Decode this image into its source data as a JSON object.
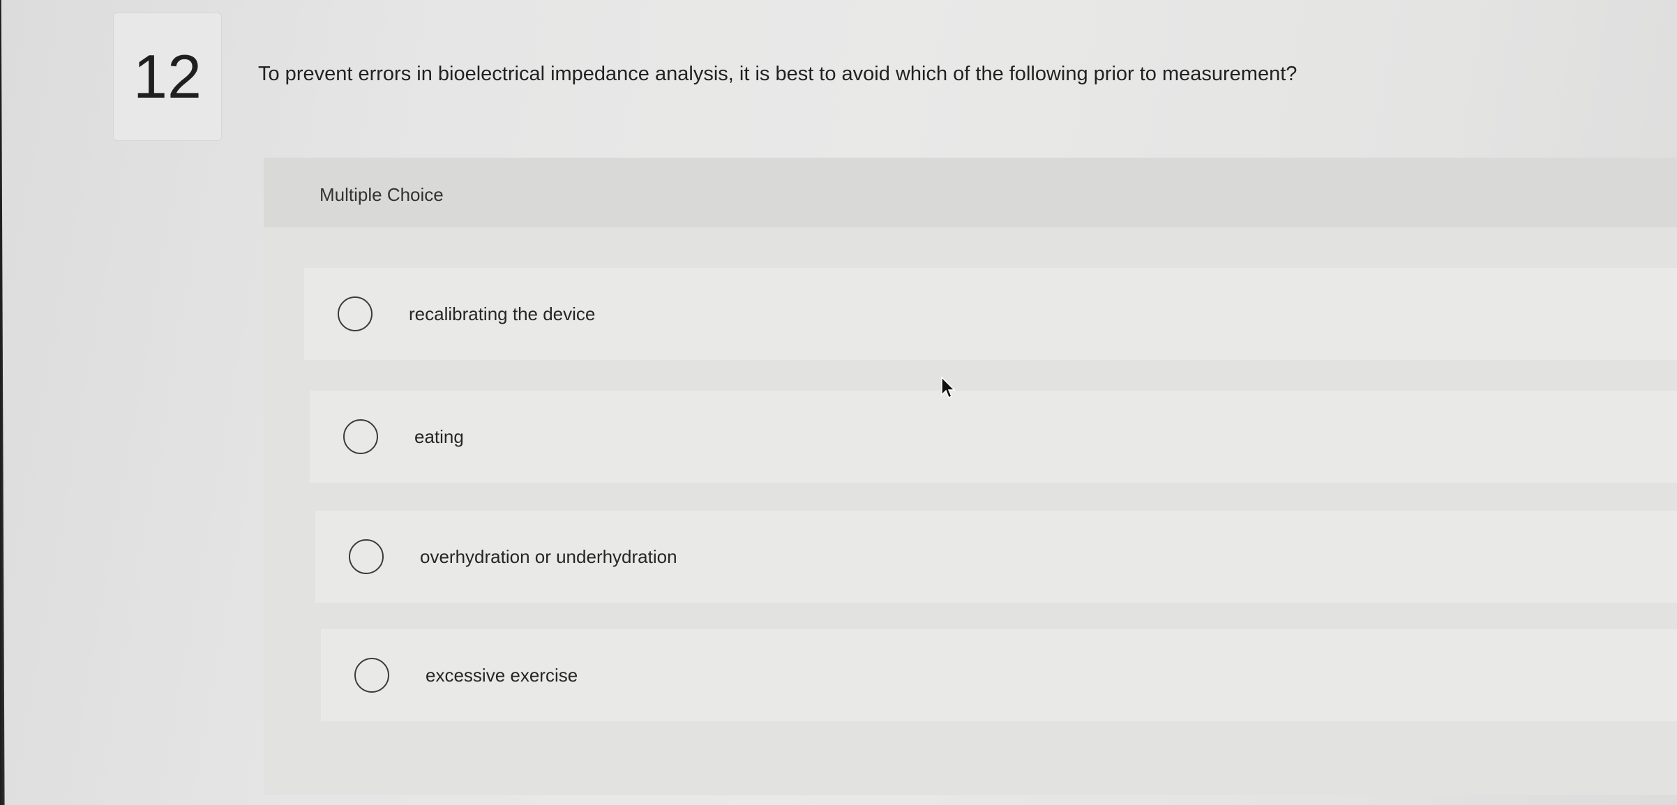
{
  "question": {
    "number": "12",
    "text": "To prevent errors in bioelectrical impedance analysis, it is best to avoid which of the following prior to measurement?"
  },
  "choices": {
    "label": "Multiple Choice",
    "options": [
      {
        "text": "recalibrating the device",
        "selected": false
      },
      {
        "text": "eating",
        "selected": false
      },
      {
        "text": "overhydration or underhydration",
        "selected": false
      },
      {
        "text": "excessive exercise",
        "selected": false
      }
    ]
  },
  "icons": {
    "radio": "radio-unselected-icon",
    "cursor": "mouse-pointer-icon"
  }
}
